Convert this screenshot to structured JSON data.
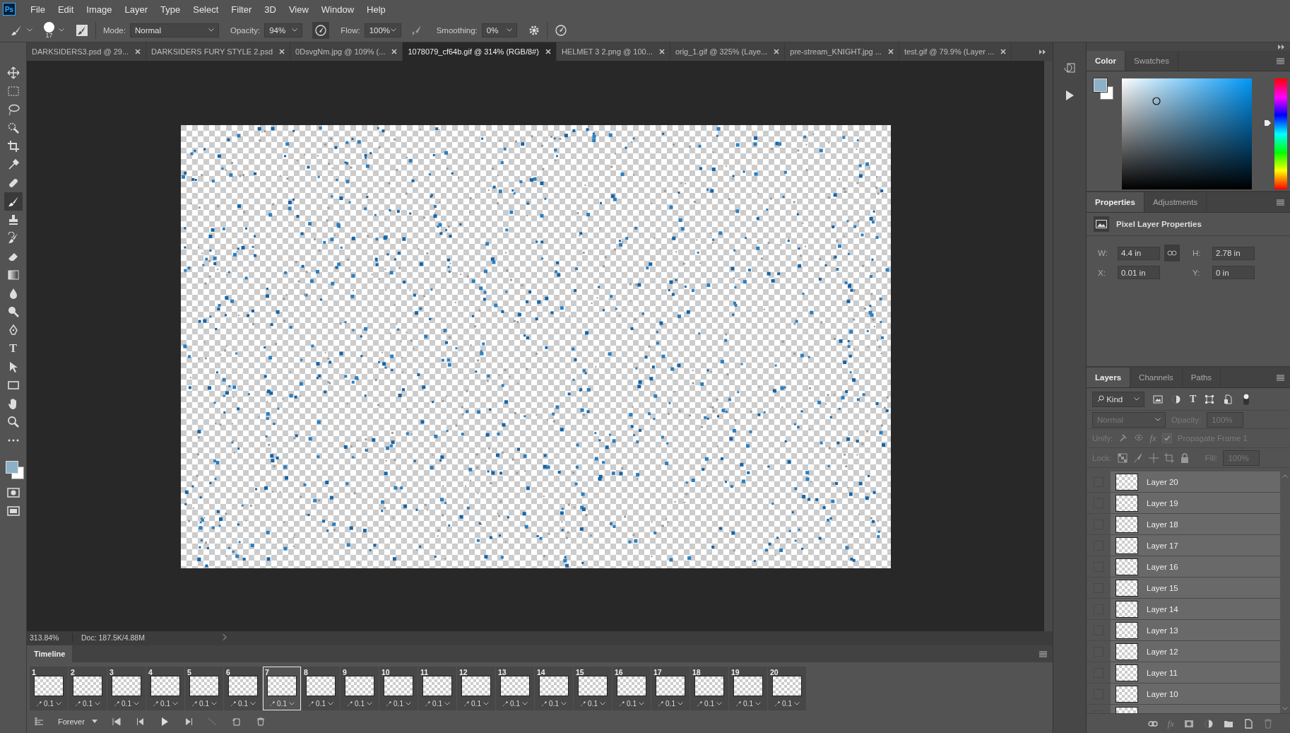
{
  "app_logo": "Ps",
  "menu": [
    "File",
    "Edit",
    "Image",
    "Layer",
    "Type",
    "Select",
    "Filter",
    "3D",
    "View",
    "Window",
    "Help"
  ],
  "options": {
    "brush_size": "17",
    "mode_label": "Mode:",
    "mode": "Normal",
    "opacity_label": "Opacity:",
    "opacity": "94%",
    "flow_label": "Flow:",
    "flow": "100%",
    "smoothing_label": "Smoothing:",
    "smoothing": "0%"
  },
  "tabs": [
    {
      "label": "DARKSIDERS3.psd @ 29...",
      "selected": false
    },
    {
      "label": "DARKSIDERS FURY STYLE 2.psd",
      "selected": false
    },
    {
      "label": "0DsvgNm.jpg @ 109% (...",
      "selected": false
    },
    {
      "label": "1078079_cf64b.gif @ 314% (RGB/8#)",
      "selected": true
    },
    {
      "label": "HELMET 3 2.png @ 100...",
      "selected": false
    },
    {
      "label": "orig_1.gif @ 325% (Laye...",
      "selected": false
    },
    {
      "label": "pre-stream_KNIGHT.jpg ...",
      "selected": false
    },
    {
      "label": "test.gif @ 79.9% (Layer ...",
      "selected": false
    }
  ],
  "text_tool_glyph": "T",
  "status": {
    "zoom": "313.84%",
    "doc": "Doc: 187.5K/4.88M"
  },
  "timeline": {
    "title": "Timeline",
    "loop": "Forever",
    "frames": [
      {
        "number": "1",
        "delay": "0.1",
        "selected": false
      },
      {
        "number": "2",
        "delay": "0.1",
        "selected": false
      },
      {
        "number": "3",
        "delay": "0.1",
        "selected": false
      },
      {
        "number": "4",
        "delay": "0.1",
        "selected": false
      },
      {
        "number": "5",
        "delay": "0.1",
        "selected": false
      },
      {
        "number": "6",
        "delay": "0.1",
        "selected": false
      },
      {
        "number": "7",
        "delay": "0.1",
        "selected": true
      },
      {
        "number": "8",
        "delay": "0.1",
        "selected": false
      },
      {
        "number": "9",
        "delay": "0.1",
        "selected": false
      },
      {
        "number": "10",
        "delay": "0.1",
        "selected": false
      },
      {
        "number": "11",
        "delay": "0.1",
        "selected": false
      },
      {
        "number": "12",
        "delay": "0.1",
        "selected": false
      },
      {
        "number": "13",
        "delay": "0.1",
        "selected": false
      },
      {
        "number": "14",
        "delay": "0.1",
        "selected": false
      },
      {
        "number": "15",
        "delay": "0.1",
        "selected": false
      },
      {
        "number": "16",
        "delay": "0.1",
        "selected": false
      },
      {
        "number": "17",
        "delay": "0.1",
        "selected": false
      },
      {
        "number": "18",
        "delay": "0.1",
        "selected": false
      },
      {
        "number": "19",
        "delay": "0.1",
        "selected": false
      },
      {
        "number": "20",
        "delay": "0.1",
        "selected": false
      }
    ]
  },
  "color_panel": {
    "tabs": [
      {
        "label": "Color",
        "selected": true
      },
      {
        "label": "Swatches",
        "selected": false
      }
    ],
    "hue_slider": {
      "level": 0.6
    }
  },
  "properties": {
    "tabs": [
      {
        "label": "Properties",
        "selected": true
      },
      {
        "label": "Adjustments",
        "selected": false
      }
    ],
    "title": "Pixel Layer Properties",
    "w_label": "W:",
    "w": "4.4 in",
    "h_label": "H:",
    "h": "2.78 in",
    "x_label": "X:",
    "x": "0.01 in",
    "y_label": "Y:",
    "y": "0 in"
  },
  "layers": {
    "tabs": [
      {
        "label": "Layers",
        "selected": true
      },
      {
        "label": "Channels",
        "selected": false
      },
      {
        "label": "Paths",
        "selected": false
      }
    ],
    "filter": "Kind",
    "type_glyph": "T",
    "blend": "Normal",
    "opacity_label": "Opacity:",
    "opacity": "100%",
    "unify_label": "Unify:",
    "unify_fx": "fx",
    "propagate": {
      "label": "Propagate Frame 1",
      "checked": true
    },
    "lock_label": "Lock:",
    "fill_label": "Fill:",
    "fill": "100%",
    "footer_fx": "fx",
    "items": [
      {
        "name": "Layer 20"
      },
      {
        "name": "Layer 19"
      },
      {
        "name": "Layer 18"
      },
      {
        "name": "Layer 17"
      },
      {
        "name": "Layer 16"
      },
      {
        "name": "Layer 15"
      },
      {
        "name": "Layer 14"
      },
      {
        "name": "Layer 13"
      },
      {
        "name": "Layer 12"
      },
      {
        "name": "Layer 11"
      },
      {
        "name": "Layer 10"
      }
    ]
  }
}
